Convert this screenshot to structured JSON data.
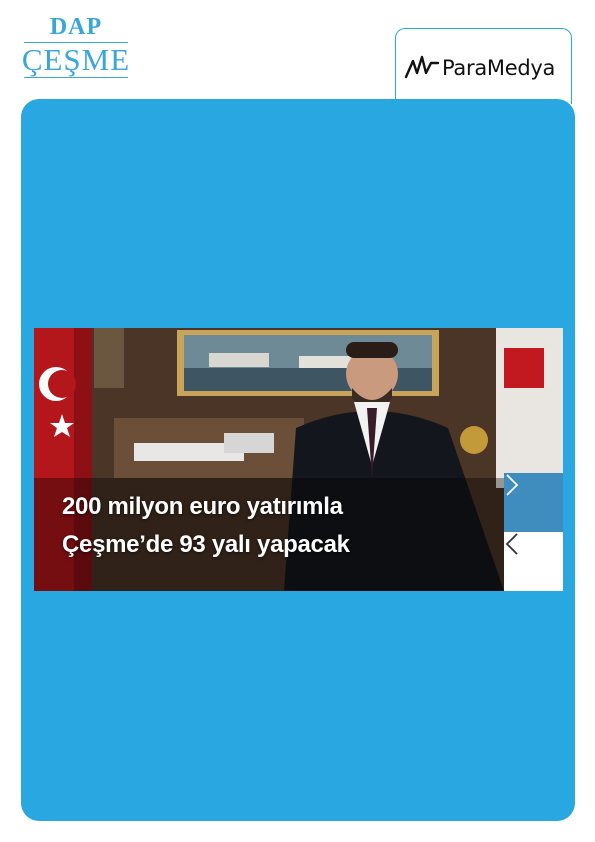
{
  "logo": {
    "line1": "DAP",
    "line2": "ÇEŞME"
  },
  "partner": {
    "name": "ParaMedya",
    "icon": "paramedya-mark-icon"
  },
  "slider": {
    "headline_line1": "200 milyon euro yatırımla",
    "headline_line2": "Çeşme’de 93 yalı yapacak",
    "next_icon": "chevron-right-icon",
    "prev_icon": "chevron-left-icon"
  },
  "colors": {
    "brand_blue": "#29a7e1",
    "logo_blue": "#3aa6dc",
    "next_button": "#3f8cbf"
  }
}
